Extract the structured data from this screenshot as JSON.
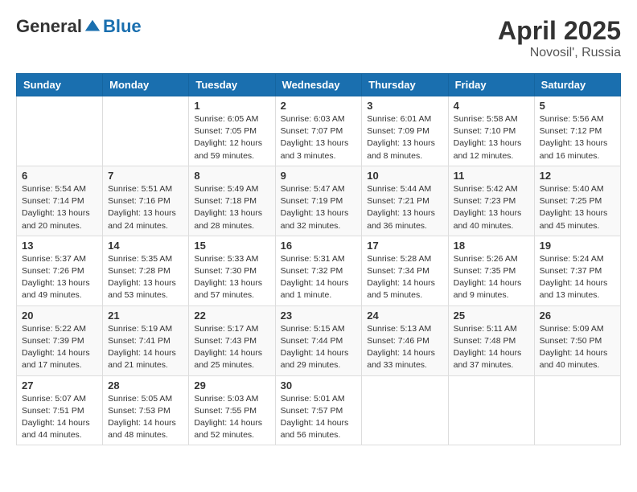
{
  "logo": {
    "general": "General",
    "blue": "Blue"
  },
  "title": "April 2025",
  "subtitle": "Novosil', Russia",
  "weekdays": [
    "Sunday",
    "Monday",
    "Tuesday",
    "Wednesday",
    "Thursday",
    "Friday",
    "Saturday"
  ],
  "weeks": [
    [
      {
        "day": "",
        "sunrise": "",
        "sunset": "",
        "daylight": ""
      },
      {
        "day": "",
        "sunrise": "",
        "sunset": "",
        "daylight": ""
      },
      {
        "day": "1",
        "sunrise": "Sunrise: 6:05 AM",
        "sunset": "Sunset: 7:05 PM",
        "daylight": "Daylight: 12 hours and 59 minutes."
      },
      {
        "day": "2",
        "sunrise": "Sunrise: 6:03 AM",
        "sunset": "Sunset: 7:07 PM",
        "daylight": "Daylight: 13 hours and 3 minutes."
      },
      {
        "day": "3",
        "sunrise": "Sunrise: 6:01 AM",
        "sunset": "Sunset: 7:09 PM",
        "daylight": "Daylight: 13 hours and 8 minutes."
      },
      {
        "day": "4",
        "sunrise": "Sunrise: 5:58 AM",
        "sunset": "Sunset: 7:10 PM",
        "daylight": "Daylight: 13 hours and 12 minutes."
      },
      {
        "day": "5",
        "sunrise": "Sunrise: 5:56 AM",
        "sunset": "Sunset: 7:12 PM",
        "daylight": "Daylight: 13 hours and 16 minutes."
      }
    ],
    [
      {
        "day": "6",
        "sunrise": "Sunrise: 5:54 AM",
        "sunset": "Sunset: 7:14 PM",
        "daylight": "Daylight: 13 hours and 20 minutes."
      },
      {
        "day": "7",
        "sunrise": "Sunrise: 5:51 AM",
        "sunset": "Sunset: 7:16 PM",
        "daylight": "Daylight: 13 hours and 24 minutes."
      },
      {
        "day": "8",
        "sunrise": "Sunrise: 5:49 AM",
        "sunset": "Sunset: 7:18 PM",
        "daylight": "Daylight: 13 hours and 28 minutes."
      },
      {
        "day": "9",
        "sunrise": "Sunrise: 5:47 AM",
        "sunset": "Sunset: 7:19 PM",
        "daylight": "Daylight: 13 hours and 32 minutes."
      },
      {
        "day": "10",
        "sunrise": "Sunrise: 5:44 AM",
        "sunset": "Sunset: 7:21 PM",
        "daylight": "Daylight: 13 hours and 36 minutes."
      },
      {
        "day": "11",
        "sunrise": "Sunrise: 5:42 AM",
        "sunset": "Sunset: 7:23 PM",
        "daylight": "Daylight: 13 hours and 40 minutes."
      },
      {
        "day": "12",
        "sunrise": "Sunrise: 5:40 AM",
        "sunset": "Sunset: 7:25 PM",
        "daylight": "Daylight: 13 hours and 45 minutes."
      }
    ],
    [
      {
        "day": "13",
        "sunrise": "Sunrise: 5:37 AM",
        "sunset": "Sunset: 7:26 PM",
        "daylight": "Daylight: 13 hours and 49 minutes."
      },
      {
        "day": "14",
        "sunrise": "Sunrise: 5:35 AM",
        "sunset": "Sunset: 7:28 PM",
        "daylight": "Daylight: 13 hours and 53 minutes."
      },
      {
        "day": "15",
        "sunrise": "Sunrise: 5:33 AM",
        "sunset": "Sunset: 7:30 PM",
        "daylight": "Daylight: 13 hours and 57 minutes."
      },
      {
        "day": "16",
        "sunrise": "Sunrise: 5:31 AM",
        "sunset": "Sunset: 7:32 PM",
        "daylight": "Daylight: 14 hours and 1 minute."
      },
      {
        "day": "17",
        "sunrise": "Sunrise: 5:28 AM",
        "sunset": "Sunset: 7:34 PM",
        "daylight": "Daylight: 14 hours and 5 minutes."
      },
      {
        "day": "18",
        "sunrise": "Sunrise: 5:26 AM",
        "sunset": "Sunset: 7:35 PM",
        "daylight": "Daylight: 14 hours and 9 minutes."
      },
      {
        "day": "19",
        "sunrise": "Sunrise: 5:24 AM",
        "sunset": "Sunset: 7:37 PM",
        "daylight": "Daylight: 14 hours and 13 minutes."
      }
    ],
    [
      {
        "day": "20",
        "sunrise": "Sunrise: 5:22 AM",
        "sunset": "Sunset: 7:39 PM",
        "daylight": "Daylight: 14 hours and 17 minutes."
      },
      {
        "day": "21",
        "sunrise": "Sunrise: 5:19 AM",
        "sunset": "Sunset: 7:41 PM",
        "daylight": "Daylight: 14 hours and 21 minutes."
      },
      {
        "day": "22",
        "sunrise": "Sunrise: 5:17 AM",
        "sunset": "Sunset: 7:43 PM",
        "daylight": "Daylight: 14 hours and 25 minutes."
      },
      {
        "day": "23",
        "sunrise": "Sunrise: 5:15 AM",
        "sunset": "Sunset: 7:44 PM",
        "daylight": "Daylight: 14 hours and 29 minutes."
      },
      {
        "day": "24",
        "sunrise": "Sunrise: 5:13 AM",
        "sunset": "Sunset: 7:46 PM",
        "daylight": "Daylight: 14 hours and 33 minutes."
      },
      {
        "day": "25",
        "sunrise": "Sunrise: 5:11 AM",
        "sunset": "Sunset: 7:48 PM",
        "daylight": "Daylight: 14 hours and 37 minutes."
      },
      {
        "day": "26",
        "sunrise": "Sunrise: 5:09 AM",
        "sunset": "Sunset: 7:50 PM",
        "daylight": "Daylight: 14 hours and 40 minutes."
      }
    ],
    [
      {
        "day": "27",
        "sunrise": "Sunrise: 5:07 AM",
        "sunset": "Sunset: 7:51 PM",
        "daylight": "Daylight: 14 hours and 44 minutes."
      },
      {
        "day": "28",
        "sunrise": "Sunrise: 5:05 AM",
        "sunset": "Sunset: 7:53 PM",
        "daylight": "Daylight: 14 hours and 48 minutes."
      },
      {
        "day": "29",
        "sunrise": "Sunrise: 5:03 AM",
        "sunset": "Sunset: 7:55 PM",
        "daylight": "Daylight: 14 hours and 52 minutes."
      },
      {
        "day": "30",
        "sunrise": "Sunrise: 5:01 AM",
        "sunset": "Sunset: 7:57 PM",
        "daylight": "Daylight: 14 hours and 56 minutes."
      },
      {
        "day": "",
        "sunrise": "",
        "sunset": "",
        "daylight": ""
      },
      {
        "day": "",
        "sunrise": "",
        "sunset": "",
        "daylight": ""
      },
      {
        "day": "",
        "sunrise": "",
        "sunset": "",
        "daylight": ""
      }
    ]
  ]
}
